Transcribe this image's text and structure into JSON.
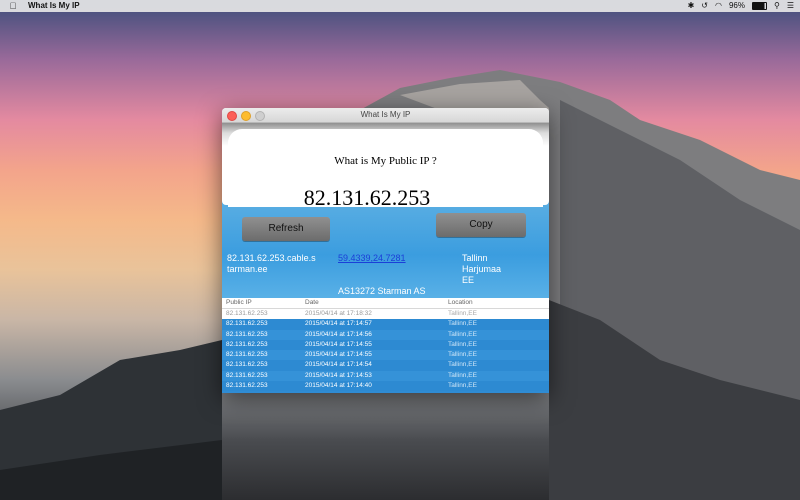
{
  "menubar": {
    "app_name": "What Is My IP",
    "battery": "96%"
  },
  "window": {
    "title": "What Is My IP",
    "question": "What is My Public IP ?",
    "ip": "82.131.62.253",
    "refresh_label": "Refresh",
    "copy_label": "Copy",
    "hostname": "82.131.62.253.cable.starman.ee",
    "coordinates": "59.4339,24.7281",
    "location_lines": [
      "Tallinn",
      "Harjumaa",
      "EE"
    ],
    "asn": "AS13272 Starman AS"
  },
  "history": {
    "headers": [
      "Public IP",
      "Date",
      "Location"
    ],
    "rows": [
      [
        "82.131.62.253",
        "2015/04/14 at 17:18:32",
        "Tallinn,EE"
      ],
      [
        "82.131.62.253",
        "2015/04/14 at 17:14:57",
        "Tallinn,EE"
      ],
      [
        "82.131.62.253",
        "2015/04/14 at 17:14:56",
        "Tallinn,EE"
      ],
      [
        "82.131.62.253",
        "2015/04/14 at 17:14:55",
        "Tallinn,EE"
      ],
      [
        "82.131.62.253",
        "2015/04/14 at 17:14:55",
        "Tallinn,EE"
      ],
      [
        "82.131.62.253",
        "2015/04/14 at 17:14:54",
        "Tallinn,EE"
      ],
      [
        "82.131.62.253",
        "2015/04/14 at 17:14:53",
        "Tallinn,EE"
      ],
      [
        "82.131.62.253",
        "2015/04/14 at 17:14:40",
        "Tallinn,EE"
      ]
    ]
  }
}
